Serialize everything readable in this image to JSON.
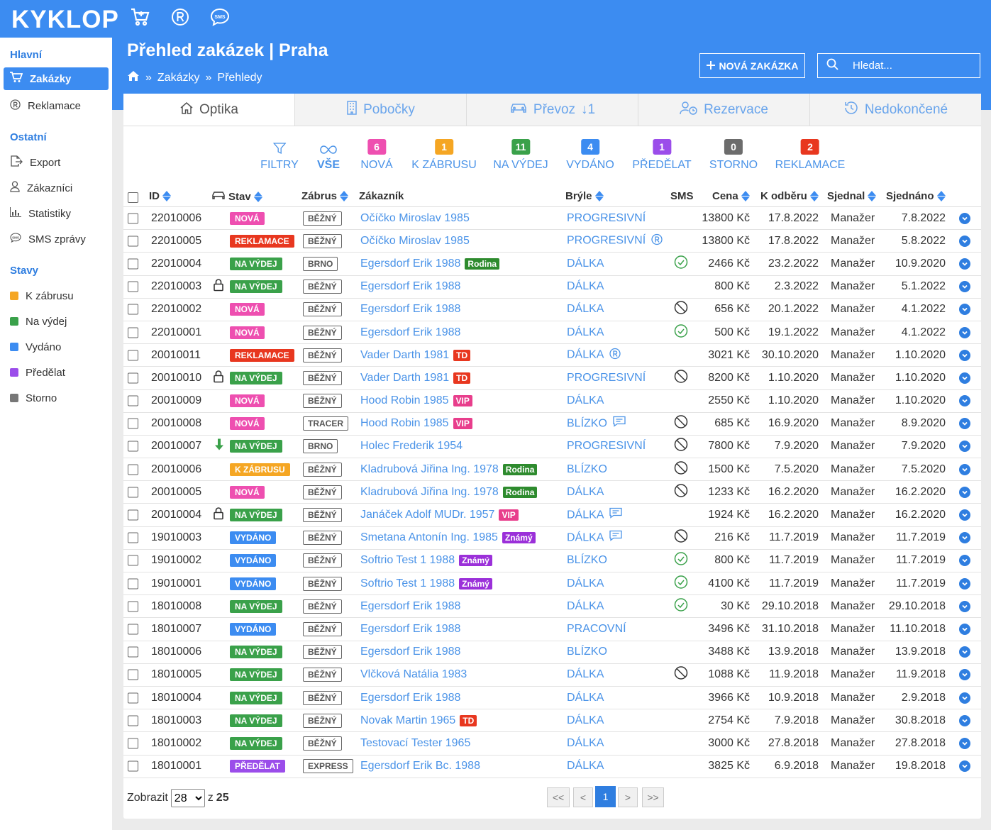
{
  "app": {
    "logo": "KYKLOP"
  },
  "header": {
    "title": "Přehled zakázek | Praha",
    "breadcrumb": [
      "Zakázky",
      "Přehledy"
    ],
    "breadcrumb_sep": "»",
    "new_button": "NOVÁ ZAKÁZKA",
    "search_placeholder": "Hledat..."
  },
  "sidebar": {
    "sections": [
      {
        "title": "Hlavní"
      },
      {
        "title": "Ostatní"
      },
      {
        "title": "Stavy"
      }
    ],
    "main_items": [
      {
        "label": "Zakázky",
        "icon": "cart-icon",
        "active": true
      },
      {
        "label": "Reklamace",
        "icon": "registered-icon"
      }
    ],
    "other_items": [
      {
        "label": "Export",
        "icon": "export-icon"
      },
      {
        "label": "Zákazníci",
        "icon": "user-icon"
      },
      {
        "label": "Statistiky",
        "icon": "chart-icon"
      },
      {
        "label": "SMS zprávy",
        "icon": "sms-icon"
      }
    ],
    "state_items": [
      {
        "label": "K zábrusu",
        "color": "#f5a623"
      },
      {
        "label": "Na výdej",
        "color": "#3aa14a"
      },
      {
        "label": "Vydáno",
        "color": "#3c8cf1"
      },
      {
        "label": "Předělat",
        "color": "#9b4dea"
      },
      {
        "label": "Storno",
        "color": "#777777"
      }
    ]
  },
  "tabs": [
    {
      "label": "Optika",
      "icon": "home-icon",
      "active": true
    },
    {
      "label": "Pobočky",
      "icon": "building-icon"
    },
    {
      "label": "Převoz",
      "icon": "car-icon",
      "extra": "↓1"
    },
    {
      "label": "Rezervace",
      "icon": "user-clock-icon"
    },
    {
      "label": "Nedokončené",
      "icon": "history-icon"
    }
  ],
  "filters": [
    {
      "label": "FILTRY",
      "icon": "filter-icon"
    },
    {
      "label": "VŠE",
      "icon": "infinity-icon",
      "active": true
    },
    {
      "label": "NOVÁ",
      "count": "6",
      "color": "#ee4fb0"
    },
    {
      "label": "K ZÁBRUSU",
      "count": "1",
      "color": "#f5a623"
    },
    {
      "label": "NA VÝDEJ",
      "count": "11",
      "color": "#3aa14a"
    },
    {
      "label": "VYDÁNO",
      "count": "4",
      "color": "#3c8cf1"
    },
    {
      "label": "PŘEDĚLAT",
      "count": "1",
      "color": "#9b4dea"
    },
    {
      "label": "STORNO",
      "count": "0",
      "color": "#6c6c6c"
    },
    {
      "label": "REKLAMACE",
      "count": "2",
      "color": "#e8371f"
    }
  ],
  "columns": {
    "id": "ID",
    "stav": "Stav",
    "zabrus": "Zábrus",
    "zakaznik": "Zákazník",
    "bryle": "Brýle",
    "sms": "SMS",
    "cena": "Cena",
    "k_odberu": "K odběru",
    "sjednal": "Sjednal",
    "sjednano": "Sjednáno"
  },
  "status_colors": {
    "NOVÁ": "#ee4fb0",
    "REKLAMACE": "#e8371f",
    "NA VÝDEJ": "#3aa14a",
    "K ZÁBRUSU": "#f5a623",
    "VYDÁNO": "#3c8cf1",
    "PŘEDĚLAT": "#9b4dea"
  },
  "tag_colors": {
    "Rodina": "#2e8b2e",
    "TD": "#e8371f",
    "VIP": "#e83e8c",
    "Známý": "#9b30d9"
  },
  "rows": [
    {
      "id": "22010006",
      "stav": "NOVÁ",
      "zabrus": "BĚŽNÝ",
      "zakaznik": "Očíčko Miroslav 1985",
      "bryle": "PROGRESIVNÍ",
      "cena": "13800 Kč",
      "k_odberu": "17.8.2022",
      "sjednal": "Manažer",
      "sjednano": "7.8.2022"
    },
    {
      "id": "22010005",
      "stav": "REKLAMACE",
      "zabrus": "BĚŽNÝ",
      "zakaznik": "Očíčko Miroslav 1985",
      "bryle": "PROGRESIVNÍ",
      "bryle_icon": "registered-icon",
      "cena": "13800 Kč",
      "k_odberu": "17.8.2022",
      "sjednal": "Manažer",
      "sjednano": "5.8.2022"
    },
    {
      "id": "22010004",
      "stav": "NA VÝDEJ",
      "zabrus": "BRNO",
      "zakaznik": "Egersdorf Erik 1988",
      "tag": "Rodina",
      "bryle": "DÁLKA",
      "sms": "ok",
      "cena": "2466 Kč",
      "k_odberu": "23.2.2022",
      "sjednal": "Manažer",
      "sjednano": "10.9.2020"
    },
    {
      "id": "22010003",
      "lock": true,
      "stav": "NA VÝDEJ",
      "zabrus": "BĚŽNÝ",
      "zakaznik": "Egersdorf Erik 1988",
      "bryle": "DÁLKA",
      "cena": "800 Kč",
      "k_odberu": "2.3.2022",
      "sjednal": "Manažer",
      "sjednano": "5.1.2022"
    },
    {
      "id": "22010002",
      "stav": "NOVÁ",
      "zabrus": "BĚŽNÝ",
      "zakaznik": "Egersdorf Erik 1988",
      "bryle": "DÁLKA",
      "sms": "no",
      "cena": "656 Kč",
      "k_odberu": "20.1.2022",
      "sjednal": "Manažer",
      "sjednano": "4.1.2022"
    },
    {
      "id": "22010001",
      "stav": "NOVÁ",
      "zabrus": "BĚŽNÝ",
      "zakaznik": "Egersdorf Erik 1988",
      "bryle": "DÁLKA",
      "sms": "ok",
      "cena": "500 Kč",
      "k_odberu": "19.1.2022",
      "sjednal": "Manažer",
      "sjednano": "4.1.2022"
    },
    {
      "id": "20010011",
      "stav": "REKLAMACE",
      "zabrus": "BĚŽNÝ",
      "zakaznik": "Vader Darth 1981",
      "tag": "TD",
      "bryle": "DÁLKA",
      "bryle_icon": "registered-icon",
      "cena": "3021 Kč",
      "k_odberu": "30.10.2020",
      "sjednal": "Manažer",
      "sjednano": "1.10.2020"
    },
    {
      "id": "20010010",
      "lock": true,
      "stav": "NA VÝDEJ",
      "zabrus": "BĚŽNÝ",
      "zakaznik": "Vader Darth 1981",
      "tag": "TD",
      "bryle": "PROGRESIVNÍ",
      "sms": "no",
      "cena": "8200 Kč",
      "k_odberu": "1.10.2020",
      "sjednal": "Manažer",
      "sjednano": "1.10.2020"
    },
    {
      "id": "20010009",
      "stav": "NOVÁ",
      "zabrus": "BĚŽNÝ",
      "zakaznik": "Hood Robin 1985",
      "tag": "VIP",
      "bryle": "DÁLKA",
      "cena": "2550 Kč",
      "k_odberu": "1.10.2020",
      "sjednal": "Manažer",
      "sjednano": "1.10.2020"
    },
    {
      "id": "20010008",
      "stav": "NOVÁ",
      "zabrus": "TRACER",
      "zakaznik": "Hood Robin 1985",
      "tag": "VIP",
      "bryle": "BLÍZKO",
      "bryle_icon": "comment-icon",
      "sms": "no",
      "cena": "685 Kč",
      "k_odberu": "16.9.2020",
      "sjednal": "Manažer",
      "sjednano": "8.9.2020"
    },
    {
      "id": "20010007",
      "arrow": true,
      "stav": "NA VÝDEJ",
      "zabrus": "BRNO",
      "zakaznik": "Holec Frederik 1954",
      "bryle": "PROGRESIVNÍ",
      "sms": "no",
      "cena": "7800 Kč",
      "k_odberu": "7.9.2020",
      "sjednal": "Manažer",
      "sjednano": "7.9.2020"
    },
    {
      "id": "20010006",
      "stav": "K ZÁBRUSU",
      "zabrus": "BĚŽNÝ",
      "zakaznik": "Kladrubová Jiřina Ing. 1978",
      "tag": "Rodina",
      "bryle": "BLÍZKO",
      "sms": "no",
      "cena": "1500 Kč",
      "k_odberu": "7.5.2020",
      "sjednal": "Manažer",
      "sjednano": "7.5.2020"
    },
    {
      "id": "20010005",
      "stav": "NOVÁ",
      "zabrus": "BĚŽNÝ",
      "zakaznik": "Kladrubová Jiřina Ing. 1978",
      "tag": "Rodina",
      "bryle": "DÁLKA",
      "sms": "no",
      "cena": "1233 Kč",
      "k_odberu": "16.2.2020",
      "sjednal": "Manažer",
      "sjednano": "16.2.2020"
    },
    {
      "id": "20010004",
      "lock": true,
      "stav": "NA VÝDEJ",
      "zabrus": "BĚŽNÝ",
      "zakaznik": "Janáček Adolf MUDr. 1957",
      "tag": "VIP",
      "bryle": "DÁLKA",
      "bryle_icon": "comment-icon",
      "cena": "1924 Kč",
      "k_odberu": "16.2.2020",
      "sjednal": "Manažer",
      "sjednano": "16.2.2020"
    },
    {
      "id": "19010003",
      "stav": "VYDÁNO",
      "zabrus": "BĚŽNÝ",
      "zakaznik": "Smetana Antonín Ing. 1985",
      "tag": "Známý",
      "bryle": "DÁLKA",
      "bryle_icon": "comment-icon",
      "sms": "no",
      "cena": "216 Kč",
      "k_odberu": "11.7.2019",
      "sjednal": "Manažer",
      "sjednano": "11.7.2019"
    },
    {
      "id": "19010002",
      "stav": "VYDÁNO",
      "zabrus": "BĚŽNÝ",
      "zakaznik": "Softrio Test 1 1988",
      "tag": "Známý",
      "bryle": "BLÍZKO",
      "sms": "ok",
      "cena": "800 Kč",
      "k_odberu": "11.7.2019",
      "sjednal": "Manažer",
      "sjednano": "11.7.2019"
    },
    {
      "id": "19010001",
      "stav": "VYDÁNO",
      "zabrus": "BĚŽNÝ",
      "zakaznik": "Softrio Test 1 1988",
      "tag": "Známý",
      "bryle": "DÁLKA",
      "sms": "ok",
      "cena": "4100 Kč",
      "k_odberu": "11.7.2019",
      "sjednal": "Manažer",
      "sjednano": "11.7.2019"
    },
    {
      "id": "18010008",
      "stav": "NA VÝDEJ",
      "zabrus": "BĚŽNÝ",
      "zakaznik": "Egersdorf Erik 1988",
      "bryle": "DÁLKA",
      "sms": "ok",
      "cena": "30 Kč",
      "k_odberu": "29.10.2018",
      "sjednal": "Manažer",
      "sjednano": "29.10.2018"
    },
    {
      "id": "18010007",
      "stav": "VYDÁNO",
      "zabrus": "BĚŽNÝ",
      "zakaznik": "Egersdorf Erik 1988",
      "bryle": "PRACOVNÍ",
      "cena": "3496 Kč",
      "k_odberu": "31.10.2018",
      "sjednal": "Manažer",
      "sjednano": "11.10.2018"
    },
    {
      "id": "18010006",
      "stav": "NA VÝDEJ",
      "zabrus": "BĚŽNÝ",
      "zakaznik": "Egersdorf Erik 1988",
      "bryle": "BLÍZKO",
      "cena": "3488 Kč",
      "k_odberu": "13.9.2018",
      "sjednal": "Manažer",
      "sjednano": "13.9.2018"
    },
    {
      "id": "18010005",
      "stav": "NA VÝDEJ",
      "zabrus": "BĚŽNÝ",
      "zakaznik": "Vlčková Natália 1983",
      "bryle": "DÁLKA",
      "sms": "no",
      "cena": "1088 Kč",
      "k_odberu": "11.9.2018",
      "sjednal": "Manažer",
      "sjednano": "11.9.2018"
    },
    {
      "id": "18010004",
      "stav": "NA VÝDEJ",
      "zabrus": "BĚŽNÝ",
      "zakaznik": "Egersdorf Erik 1988",
      "bryle": "DÁLKA",
      "cena": "3966 Kč",
      "k_odberu": "10.9.2018",
      "sjednal": "Manažer",
      "sjednano": "2.9.2018"
    },
    {
      "id": "18010003",
      "stav": "NA VÝDEJ",
      "zabrus": "BĚŽNÝ",
      "zakaznik": "Novak Martin 1965",
      "tag": "TD",
      "bryle": "DÁLKA",
      "cena": "2754 Kč",
      "k_odberu": "7.9.2018",
      "sjednal": "Manažer",
      "sjednano": "30.8.2018"
    },
    {
      "id": "18010002",
      "stav": "NA VÝDEJ",
      "zabrus": "BĚŽNÝ",
      "zakaznik": "Testovací Tester 1965",
      "bryle": "DÁLKA",
      "cena": "3000 Kč",
      "k_odberu": "27.8.2018",
      "sjednal": "Manažer",
      "sjednano": "27.8.2018"
    },
    {
      "id": "18010001",
      "stav": "PŘEDĚLAT",
      "zabrus": "EXPRESS",
      "zakaznik": "Egersdorf Erik Bc. 1988",
      "bryle": "DÁLKA",
      "cena": "3825 Kč",
      "k_odberu": "6.9.2018",
      "sjednal": "Manažer",
      "sjednano": "19.8.2018"
    }
  ],
  "footer": {
    "show_label": "Zobrazit",
    "page_size": "28",
    "of_label": "z",
    "total": "25",
    "pagination": [
      "<<",
      "<",
      "1",
      ">",
      ">>"
    ],
    "current_page": "1"
  }
}
